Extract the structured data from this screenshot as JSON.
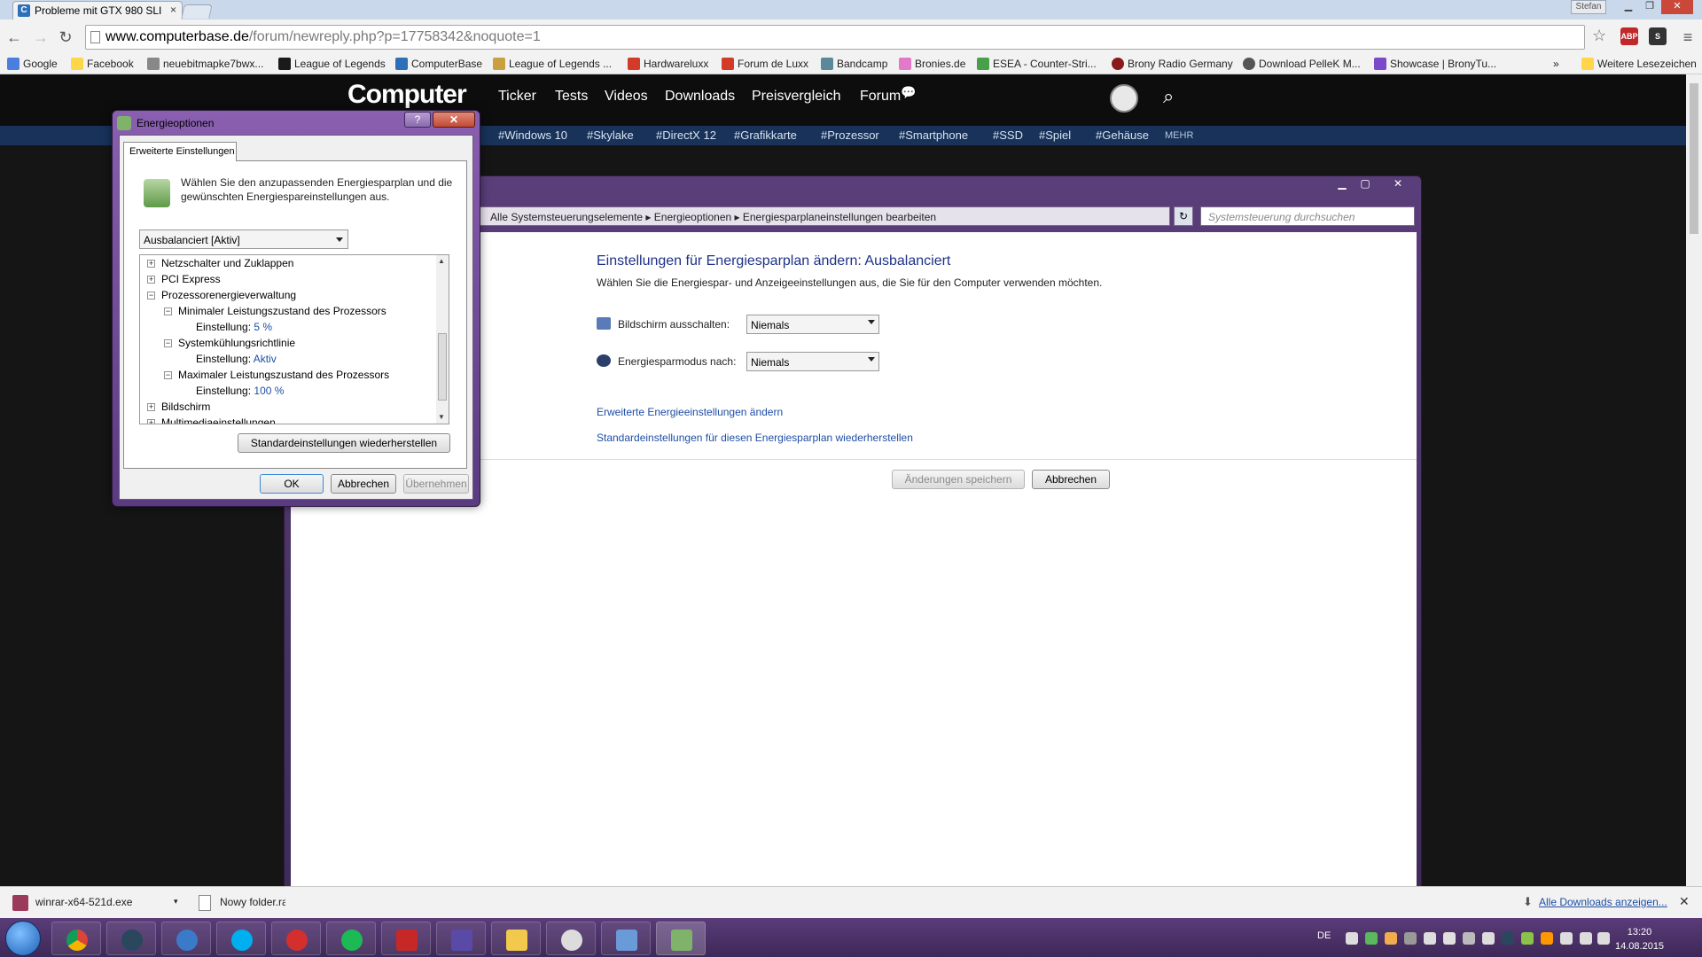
{
  "browser": {
    "tab_title": "Probleme mit GTX 980 SLI",
    "tab_close": "×",
    "user_badge": "Stefan",
    "url_host": "www.computerbase.de",
    "url_rest": "/forum/newreply.php?p=17758342&noquote=1",
    "bookmarks": [
      "Google",
      "Facebook",
      "neuebitmapke7bwx...",
      "League of Legends",
      "ComputerBase",
      "League of Legends ...",
      "Hardwareluxx",
      "Forum de Luxx",
      "Bandcamp",
      "Bronies.de",
      "ESEA - Counter-Stri...",
      "Brony Radio Germany",
      "Download PelleK M...",
      "Showcase | BronyTu..."
    ],
    "bookmarks_more": "»",
    "other_bookmarks": "Weitere Lesezeichen",
    "ext_labels": [
      "ABP",
      "S"
    ]
  },
  "site": {
    "logo": "Computer",
    "nav": [
      "Ticker",
      "Tests",
      "Videos",
      "Downloads",
      "Preisvergleich",
      "Forum"
    ],
    "tags": [
      "#Windows 10",
      "#Skylake",
      "#DirectX 12",
      "#Grafikkarte",
      "#Prozessor",
      "#Smartphone",
      "#SSD",
      "#Spiel",
      "#Gehäuse"
    ],
    "tags_more": "MEHR"
  },
  "control_panel": {
    "breadcrumb": "Alle Systemsteuerungselemente  ▸  Energieoptionen  ▸  Energiesparplaneinstellungen bearbeiten",
    "search_placeholder": "Systemsteuerung durchsuchen",
    "title": "Einstellungen für Energiesparplan ändern: Ausbalanciert",
    "subtitle": "Wählen Sie die Energiespar- und Anzeigeeinstellungen aus, die Sie für den Computer verwenden möchten.",
    "display_off_label": "Bildschirm ausschalten:",
    "display_off_value": "Niemals",
    "sleep_label": "Energiesparmodus nach:",
    "sleep_value": "Niemals",
    "link_advanced": "Erweiterte Energieeinstellungen ändern",
    "link_restore": "Standardeinstellungen für diesen Energiesparplan wiederherstellen",
    "save_button": "Änderungen speichern",
    "cancel_button": "Abbrechen"
  },
  "dialog": {
    "title": "Energieoptionen",
    "help": "?",
    "close": "✕",
    "tab": "Erweiterte Einstellungen",
    "description": "Wählen Sie den anzupassenden Energiesparplan und die gewünschten Energiespareinstellungen aus.",
    "plan": "Ausbalanciert [Aktiv]",
    "tree": [
      {
        "label": "Netzschalter und Zuklappen",
        "sign": "+",
        "level": 0
      },
      {
        "label": "PCI Express",
        "sign": "+",
        "level": 0
      },
      {
        "label": "Prozessorenergieverwaltung",
        "sign": "−",
        "level": 0
      },
      {
        "label": "Minimaler Leistungszustand des Prozessors",
        "sign": "−",
        "level": 1
      },
      {
        "label": "Einstellung:",
        "value": "5 %",
        "level": 2
      },
      {
        "label": "Systemkühlungsrichtlinie",
        "sign": "−",
        "level": 1
      },
      {
        "label": "Einstellung:",
        "value": "Aktiv",
        "level": 2
      },
      {
        "label": "Maximaler Leistungszustand des Prozessors",
        "sign": "−",
        "level": 1
      },
      {
        "label": "Einstellung:",
        "value": "100 %",
        "level": 2
      },
      {
        "label": "Bildschirm",
        "sign": "+",
        "level": 0
      },
      {
        "label": "Multimediaeinstellungen",
        "sign": "+",
        "level": 0
      }
    ],
    "restore_button": "Standardeinstellungen wiederherstellen",
    "ok": "OK",
    "cancel": "Abbrechen",
    "apply": "Übernehmen"
  },
  "downloads": {
    "item1": "winrar-x64-521d.exe",
    "item2": "Nowy folder.rar",
    "show_all": "Alle Downloads anzeigen...",
    "close": "✕"
  },
  "taskbar": {
    "apps": [
      "chrome-icon",
      "steam-icon",
      "media-icon",
      "skype-icon",
      "record-icon",
      "spotify-icon",
      "flash-icon",
      "cpu-icon",
      "explorer-icon",
      "alien-icon",
      "control-panel-icon",
      "power-options-icon"
    ],
    "language": "DE",
    "time": "13:20",
    "date": "14.08.2015"
  },
  "colors": {
    "link": "#1e4ea5",
    "cp_title": "#1e3287",
    "taskbar": "#4a3268",
    "site_tagbar": "#18325a"
  }
}
